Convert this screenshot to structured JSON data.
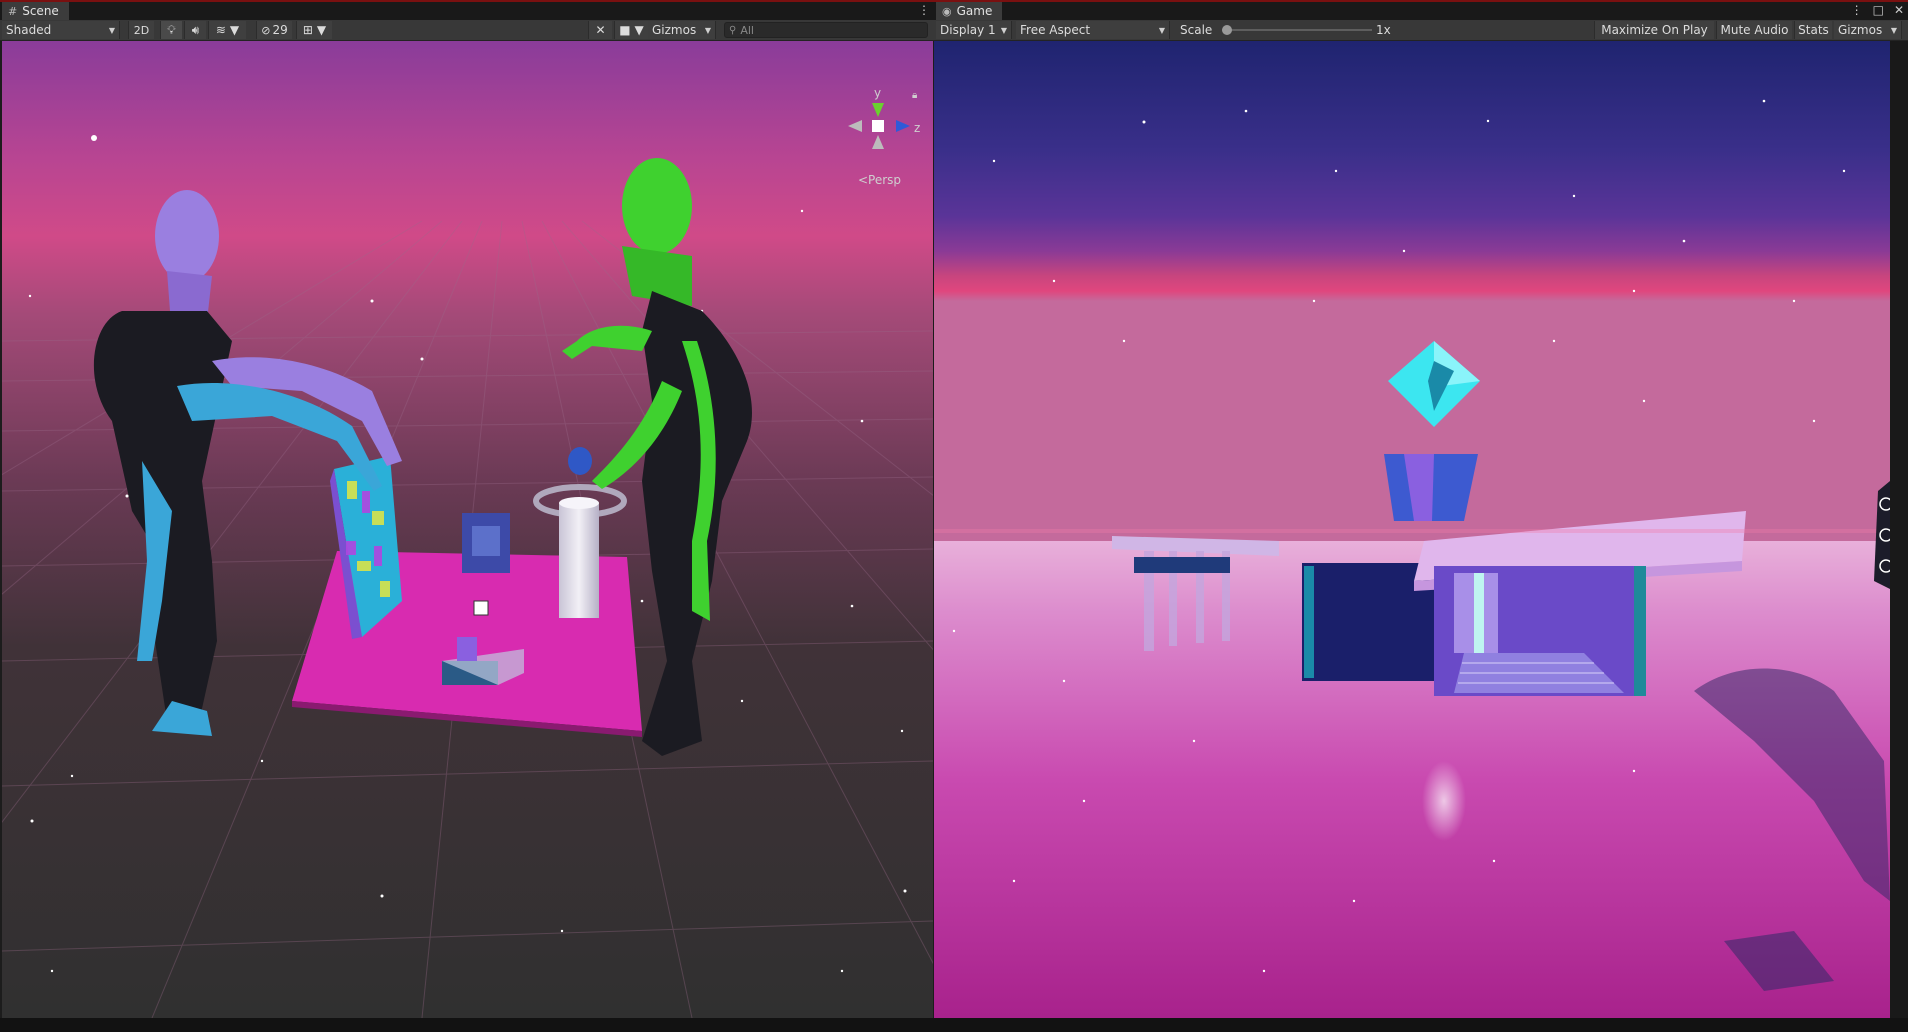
{
  "scene": {
    "tab_label": "Scene",
    "shading_mode": "Shaded",
    "toggle_2d": "2D",
    "hidden_count": "29",
    "gizmos_label": "Gizmos",
    "search_placeholder": "All",
    "axis_y": "y",
    "axis_z": "z",
    "persp_label": "<Persp"
  },
  "game": {
    "tab_label": "Game",
    "display": "Display 1",
    "aspect": "Free Aspect",
    "scale_label": "Scale",
    "scale_value": "1x",
    "scale_fraction": 0.0,
    "maximize_label": "Maximize On Play",
    "mute_label": "Mute Audio",
    "stats_label": "Stats",
    "gizmos_label": "Gizmos"
  },
  "colors": {
    "sky_top": "#3a2f8a",
    "sky_horizon": "#e0467e",
    "ground_pink": "#c02590",
    "grid_dark": "#2a2a2a",
    "alien_green": "#3fd12f",
    "alien_purple": "#9a7fe0",
    "alien_blue": "#3aa6d8",
    "crystal_cyan": "#3ce6f0",
    "mat_magenta": "#e021b2"
  }
}
